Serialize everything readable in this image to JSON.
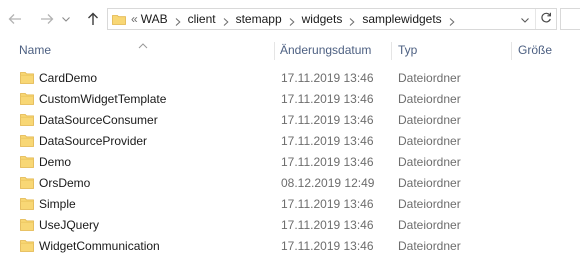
{
  "navigation": {
    "back_icon": "arrow-left-icon",
    "forward_icon": "arrow-right-icon",
    "recent_icon": "chevron-down-icon",
    "up_icon": "arrow-up-icon"
  },
  "address_bar": {
    "overflow_chevron": "«",
    "breadcrumbs": [
      "WAB",
      "client",
      "stemapp",
      "widgets",
      "samplewidgets"
    ],
    "dropdown_icon": "chevron-down-icon",
    "refresh_icon": "refresh-icon"
  },
  "columns": {
    "name": "Name",
    "date": "Änderungsdatum",
    "type": "Typ",
    "size": "Größe"
  },
  "files": [
    {
      "name": "CardDemo",
      "date": "17.11.2019 13:46",
      "type": "Dateiordner",
      "size": ""
    },
    {
      "name": "CustomWidgetTemplate",
      "date": "17.11.2019 13:46",
      "type": "Dateiordner",
      "size": ""
    },
    {
      "name": "DataSourceConsumer",
      "date": "17.11.2019 13:46",
      "type": "Dateiordner",
      "size": ""
    },
    {
      "name": "DataSourceProvider",
      "date": "17.11.2019 13:46",
      "type": "Dateiordner",
      "size": ""
    },
    {
      "name": "Demo",
      "date": "17.11.2019 13:46",
      "type": "Dateiordner",
      "size": ""
    },
    {
      "name": "OrsDemo",
      "date": "08.12.2019 12:49",
      "type": "Dateiordner",
      "size": ""
    },
    {
      "name": "Simple",
      "date": "17.11.2019 13:46",
      "type": "Dateiordner",
      "size": ""
    },
    {
      "name": "UseJQuery",
      "date": "17.11.2019 13:46",
      "type": "Dateiordner",
      "size": ""
    },
    {
      "name": "WidgetCommunication",
      "date": "17.11.2019 13:46",
      "type": "Dateiordner",
      "size": ""
    }
  ],
  "colors": {
    "folder_fill": "#f8d775",
    "folder_tab": "#e8b84a",
    "header_text": "#4d6082",
    "secondary_text": "#6d6d6d"
  }
}
